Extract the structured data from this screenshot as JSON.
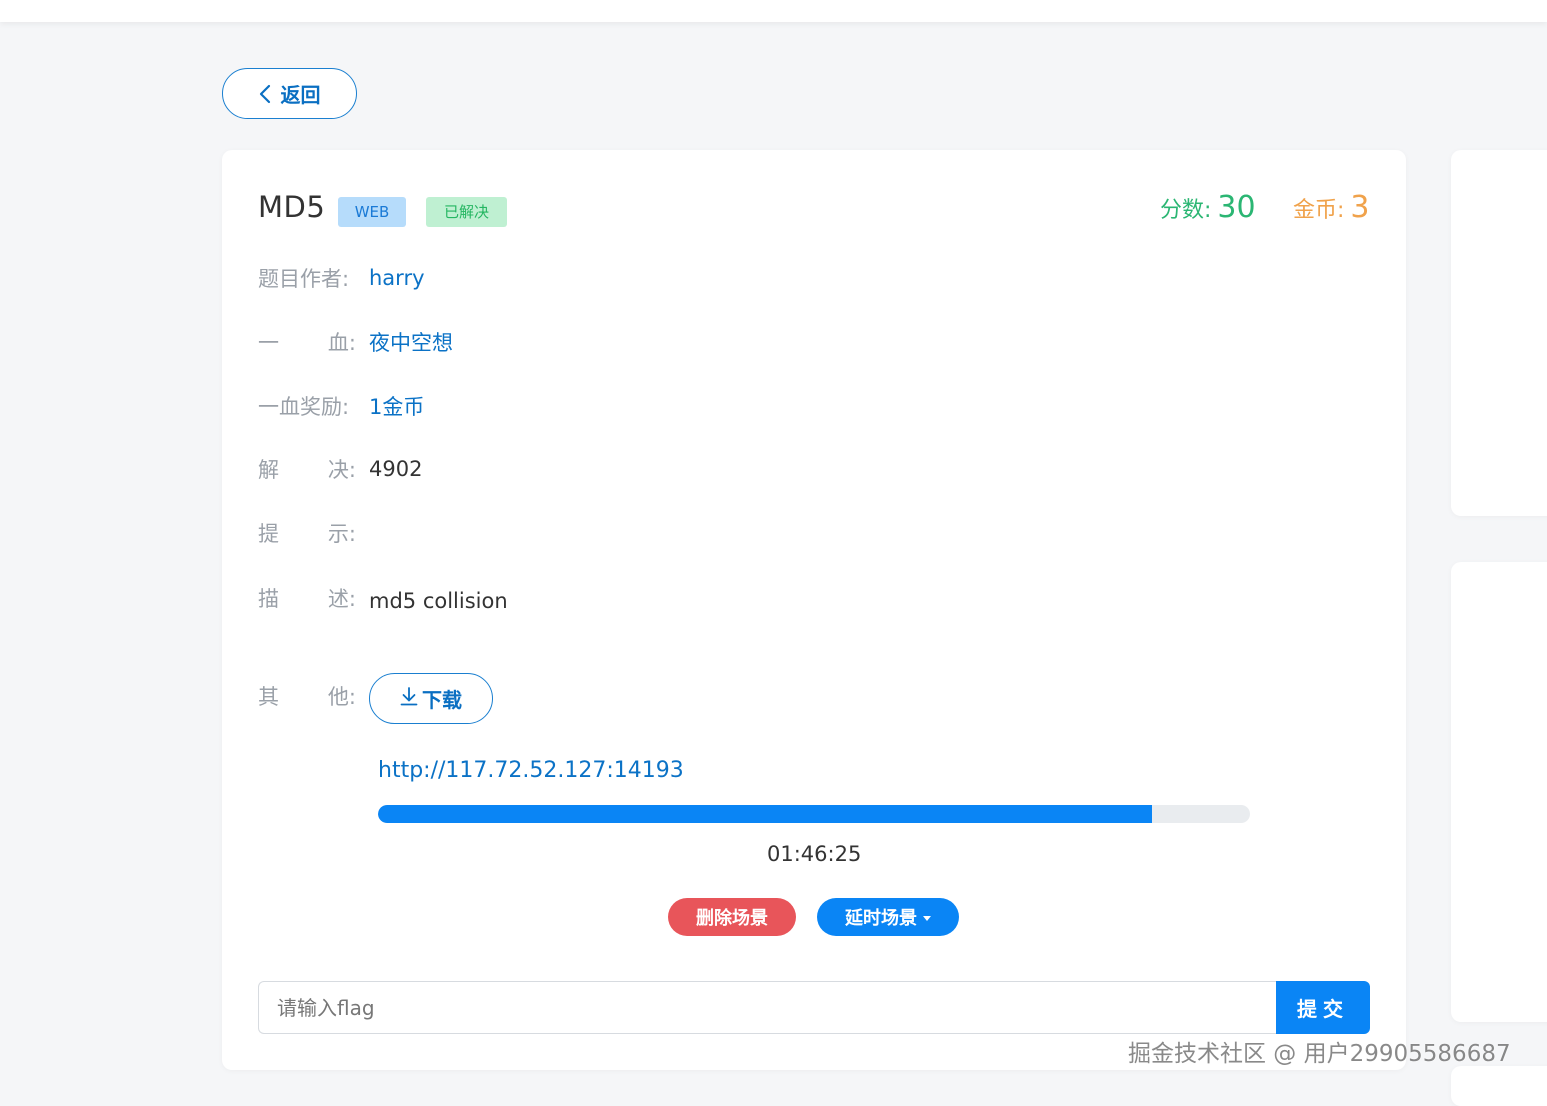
{
  "nav": {
    "back_label": "返回"
  },
  "challenge": {
    "title": "MD5",
    "category_tag": "WEB",
    "status_tag": "已解决",
    "score_label": "分数:",
    "score_value": "30",
    "coin_label": "金币:",
    "coin_value": "3",
    "fields": {
      "author": {
        "label_a": "题目作者",
        "label_b": "",
        "colon": ":",
        "value": "harry"
      },
      "first_blood": {
        "label_a": "一",
        "label_b": "血",
        "colon": ":",
        "value": "夜中空想"
      },
      "first_blood_reward": {
        "label_a": "一血奖励",
        "label_b": "",
        "colon": ":",
        "value": "1金币"
      },
      "solves": {
        "label_a": "解",
        "label_b": "决",
        "colon": ":",
        "value": "4902"
      },
      "hint": {
        "label_a": "提",
        "label_b": "示",
        "colon": ":",
        "value": ""
      },
      "description": {
        "label_a": "描",
        "label_b": "述",
        "colon": ":",
        "value": "md5 collision"
      },
      "other": {
        "label_a": "其",
        "label_b": "他",
        "colon": ":"
      }
    },
    "download_label": "下载"
  },
  "environment": {
    "url": "http://117.72.52.127:14193",
    "progress_fraction": 0.888,
    "countdown": "01:46:25",
    "delete_label": "删除场景",
    "delay_label": "延时场景"
  },
  "flag_form": {
    "placeholder": "请输入flag",
    "value": "",
    "submit_label": "提交"
  },
  "watermark": {
    "text": "掘金技术社区 @ 用户29905586687"
  },
  "colors": {
    "primary": "#0a85f5",
    "link": "#0b72c6",
    "score_green": "#2bb673",
    "coin_orange": "#f0a24b",
    "danger": "#e8555a",
    "tag_web_bg": "#b6dcfb",
    "tag_solved_bg": "#bff0d2"
  },
  "icons": {
    "back": "chevron-left-icon",
    "download": "download-arrow-icon",
    "dropdown": "caret-down-icon"
  }
}
